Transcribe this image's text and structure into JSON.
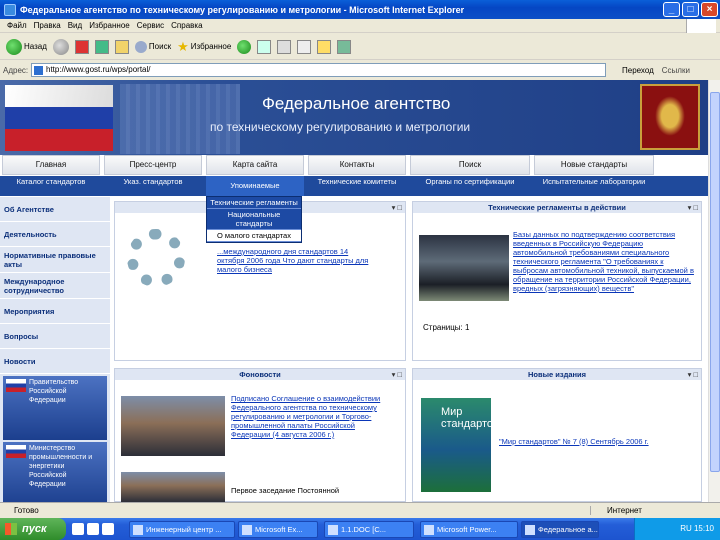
{
  "window": {
    "title": "Федеральное агентство по техническому регулированию и метрологии - Microsoft Internet Explorer"
  },
  "menu": [
    "Файл",
    "Правка",
    "Вид",
    "Избранное",
    "Сервис",
    "Справка"
  ],
  "toolbar": {
    "back": "Назад",
    "search": "Поиск",
    "favorites": "Избранное"
  },
  "address": {
    "label": "Адрес:",
    "url": "http://www.gost.ru/wps/portal/",
    "go": "Переход",
    "links": "Ссылки"
  },
  "site": {
    "title_line1": "Федеральное агентство",
    "title_line2": "по техническому регулированию и метрологии",
    "nav_top": [
      "Главная",
      "Пресс-центр",
      "Карта сайта",
      "Контакты",
      "Поиск",
      "Новые стандарты"
    ],
    "nav_sub": [
      "Каталог стандартов",
      "Указ. стандартов",
      "Упоминаемые",
      "Технические комитеты",
      "Органы по сертификации",
      "Испытательные лаборатории"
    ],
    "dropdown": [
      "Технические регламенты",
      "Национальные стандарты",
      "О малого стандартах"
    ],
    "sidebar": [
      "Об Агентстве",
      "Деятельность",
      "Нормативные правовые акты",
      "Международное сотрудничество",
      "Мероприятия",
      "Вопросы",
      "Новости"
    ],
    "side_banners": [
      "Правительство Российской Федерации",
      "Министерство промышленности и энергетики Российской Федерации"
    ]
  },
  "panels": {
    "p1": {
      "header": "",
      "ctrl": "▾ □",
      "text": "...международного дня стандартов 14 октября 2006 года Что дают стандарты для малого бизнеса"
    },
    "p2": {
      "header": "Технические регламенты в действии",
      "ctrl": "▾ □",
      "text": "Базы данных по подтверждению соответствия введенных в Российскую Федерацию автомобильной требованиями специального технического регламента \"О требованиях к выбросам автомобильной техникой, выпускаемой в обращение на территории Российской Федерации, вредных (загрязняющих) веществ\"",
      "pages": "Страницы: 1"
    },
    "p3": {
      "header": "Фоновости",
      "ctrl": "▾ □",
      "text1": "Подписано Соглашение о взаимодействии Федерального агентства по техническому регулированию и метрологии и Торгово-промышленной палаты Российской Федерации (4 августа 2006 г.)",
      "text2": "Первое заседание Постоянной"
    },
    "p4": {
      "header": "Новые издания",
      "ctrl": "▾ □",
      "mag_title": "Мир стандартов",
      "text": "\"Мир стандартов\" № 7 (8) Сентябрь 2006 г."
    }
  },
  "status": {
    "left": "Готово",
    "right": "Интернет"
  },
  "taskbar": {
    "start": "пуск",
    "tasks": [
      "Инженерный центр ...",
      "Microsoft Ex...",
      "1.1.DOC [С...",
      "Microsoft Power...",
      "Федеральное а..."
    ],
    "clock": "RU 15:10"
  }
}
